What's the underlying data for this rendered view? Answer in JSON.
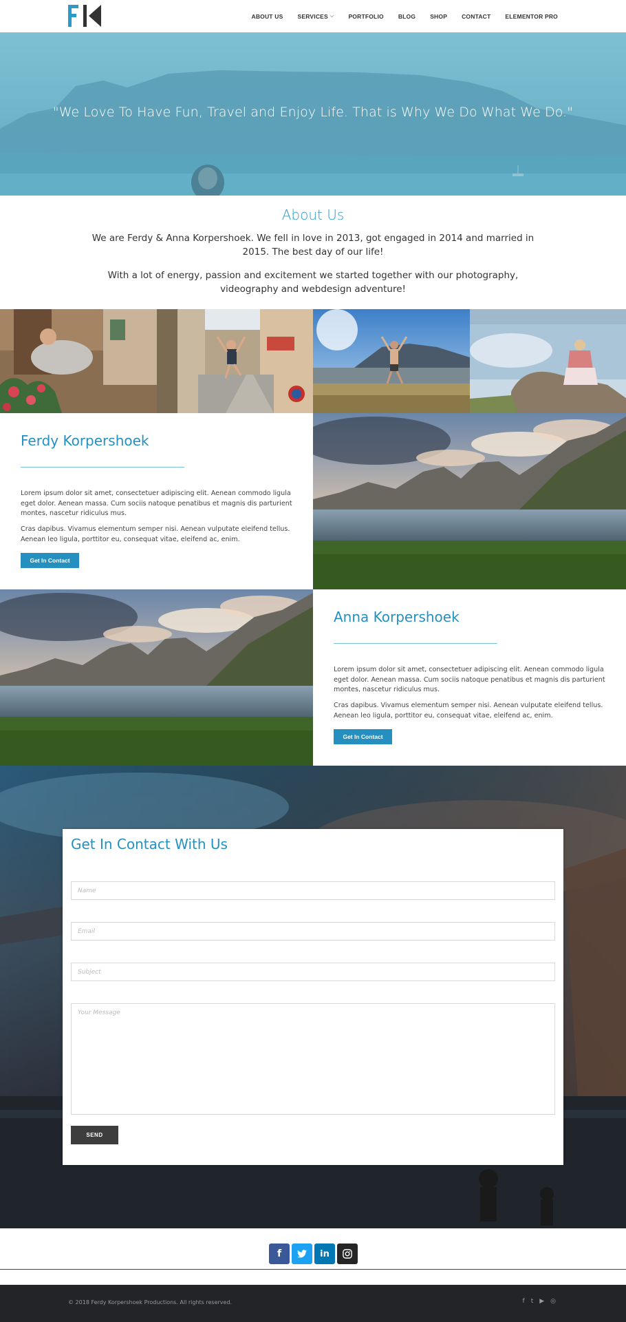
{
  "header": {
    "logo_alt": "FK logo",
    "nav": [
      {
        "label": "ABOUT US"
      },
      {
        "label": "SERVICES",
        "has_dropdown": true
      },
      {
        "label": "PORTFOLIO"
      },
      {
        "label": "BLOG"
      },
      {
        "label": "SHOP"
      },
      {
        "label": "CONTACT"
      },
      {
        "label": "ELEMENTOR PRO"
      }
    ]
  },
  "hero": {
    "quote": "\"We Love To Have Fun, Travel and Enjoy Life. That is Why We Do What We Do.\""
  },
  "about": {
    "title": "About Us",
    "paragraphs": [
      "We are Ferdy & Anna Korpershoek. We fell in love in 2013, got engaged in 2014 and married in 2015. The best day of our life!",
      "With a lot of energy, passion and excitement we started together with our photography, videography and webdesign adventure!"
    ]
  },
  "profiles": [
    {
      "name": "Ferdy Korpershoek",
      "p1": "Lorem ipsum dolor sit amet, consectetuer adipiscing elit. Aenean commodo ligula eget dolor. Aenean massa. Cum sociis natoque penatibus et magnis dis parturient montes, nascetur ridiculus mus.",
      "p2": "Cras dapibus. Vivamus elementum semper nisi. Aenean vulputate eleifend tellus. Aenean leo ligula, porttitor eu, consequat vitae, eleifend ac, enim.",
      "button": "Get In Contact"
    },
    {
      "name": "Anna Korpershoek",
      "p1": "Lorem ipsum dolor sit amet, consectetuer adipiscing elit. Aenean commodo ligula eget dolor. Aenean massa. Cum sociis natoque penatibus et magnis dis parturient montes, nascetur ridiculus mus.",
      "p2": "Cras dapibus. Vivamus elementum semper nisi. Aenean vulputate eleifend tellus. Aenean leo ligula, porttitor eu, consequat vitae, eleifend ac, enim.",
      "button": "Get In Contact"
    }
  ],
  "contact": {
    "title": "Get In Contact With Us",
    "name_placeholder": "Name",
    "email_placeholder": "Email",
    "subject_placeholder": "Subject",
    "message_placeholder": "Your Message",
    "send_label": "SEND"
  },
  "social": [
    {
      "icon": "facebook-icon",
      "glyph": "f",
      "color": "#3b5998"
    },
    {
      "icon": "twitter-icon",
      "glyph": "🐦",
      "color": "#1da1f2"
    },
    {
      "icon": "linkedin-icon",
      "glyph": "in",
      "color": "#0077b5"
    },
    {
      "icon": "instagram-icon",
      "glyph": "◎",
      "color": "#262626"
    }
  ],
  "footer": {
    "copyright": "© 2018 Ferdy Korpershoek Productions. All rights reserved.",
    "icons": [
      "f",
      "t",
      "▶",
      "◎"
    ]
  },
  "colors": {
    "accent": "#2490bf",
    "footer_bg": "#222427",
    "send_bg": "#3d3d3d"
  }
}
